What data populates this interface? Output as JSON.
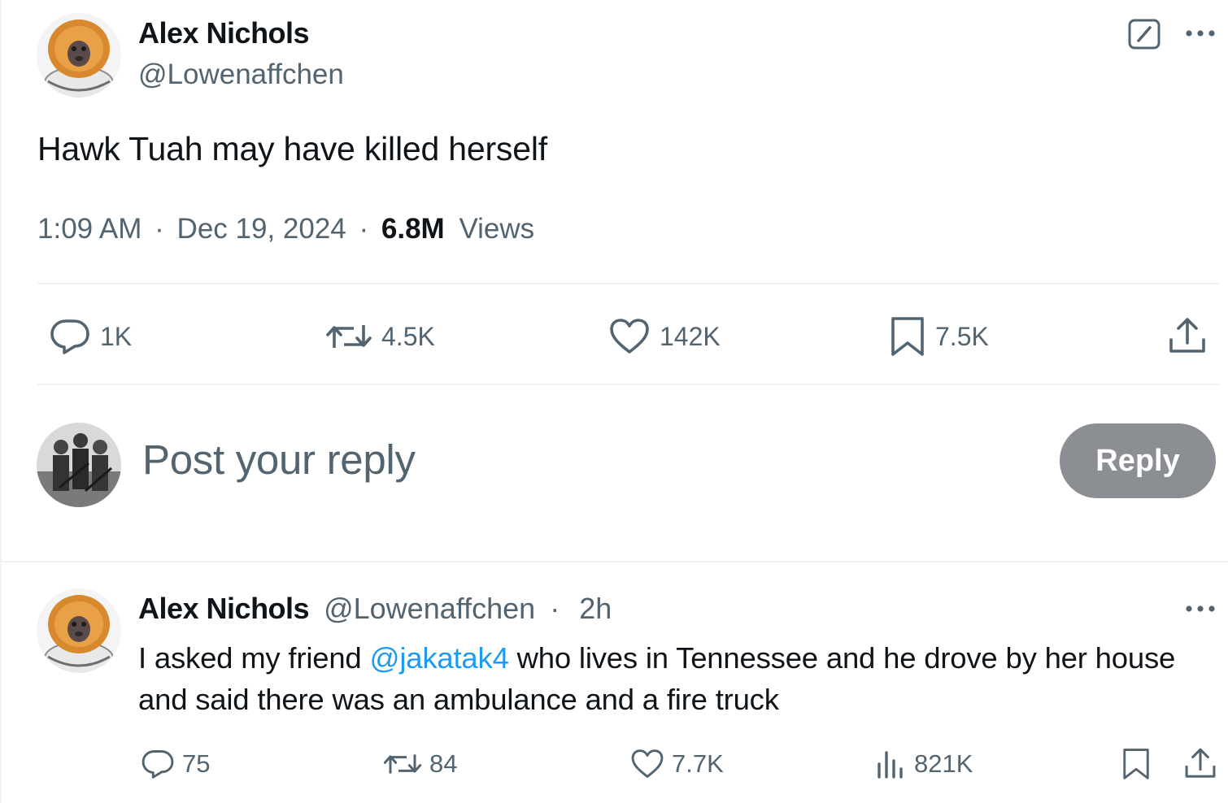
{
  "tweet": {
    "author_name": "Alex Nichols",
    "author_handle": "@Lowenaffchen",
    "text": "Hawk Tuah may have killed herself",
    "time": "1:09 AM",
    "date": "Dec 19, 2024",
    "separator": "·",
    "views_count": "6.8M",
    "views_label": "Views",
    "actions": {
      "replies": "1K",
      "reposts": "4.5K",
      "likes": "142K",
      "bookmarks": "7.5K"
    }
  },
  "reply_box": {
    "placeholder": "Post your reply",
    "button_label": "Reply"
  },
  "comment": {
    "author_name": "Alex Nichols",
    "author_handle": "@Lowenaffchen",
    "separator": "·",
    "time": "2h",
    "text_before": "I asked my friend ",
    "mention": "@jakatak4",
    "text_after": " who lives in Tennessee and he drove by her house and said there was an ambulance and a fire truck",
    "actions": {
      "replies": "75",
      "reposts": "84",
      "likes": "7.7K",
      "views": "821K"
    }
  },
  "icons": {
    "reply": "speech-bubble-icon",
    "repost": "repost-arrows-icon",
    "like": "heart-icon",
    "bookmark": "bookmark-icon",
    "share": "share-upload-icon",
    "views": "bar-chart-icon",
    "grok": "grok-slash-icon",
    "more": "ellipsis-icon"
  },
  "colors": {
    "text_primary": "#0f1419",
    "text_secondary": "#536471",
    "link": "#1d9bf0",
    "reply_button_disabled": "#8b8f93",
    "divider": "#eff3f4"
  }
}
